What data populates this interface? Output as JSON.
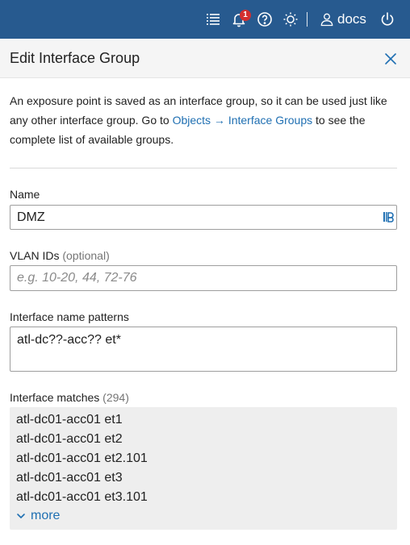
{
  "topbar": {
    "notification_count": "1",
    "user_name": "docs",
    "icons": [
      "list-icon",
      "bell-icon",
      "help-icon",
      "sun-icon",
      "user-icon",
      "power-icon"
    ],
    "bg_color": "#275a8f"
  },
  "dialog": {
    "title": "Edit Interface Group",
    "description": {
      "part1": "An exposure point is saved as an interface group, so it can be used just like any other interface group. Go to ",
      "link_objects": "Objects",
      "arrow": " → ",
      "link_groups": "Interface Groups",
      "part2": " to see the complete list of available groups."
    },
    "name": {
      "label": "Name",
      "value": "DMZ"
    },
    "vlan": {
      "label": "VLAN IDs",
      "optional": "(optional)",
      "placeholder": "e.g. 10-20, 44, 72-76",
      "value": ""
    },
    "patterns": {
      "label": "Interface name patterns",
      "value": "atl-dc??-acc?? et*"
    },
    "matches": {
      "label": "Interface matches",
      "count": "(294)",
      "items": [
        "atl-dc01-acc01 et1",
        "atl-dc01-acc01 et2",
        "atl-dc01-acc01 et2.101",
        "atl-dc01-acc01 et3",
        "atl-dc01-acc01 et3.101"
      ],
      "more_label": "more"
    }
  },
  "colors": {
    "accent": "#1f6fb2",
    "badge": "#d32f2f",
    "match_bg": "#eeeeee"
  }
}
